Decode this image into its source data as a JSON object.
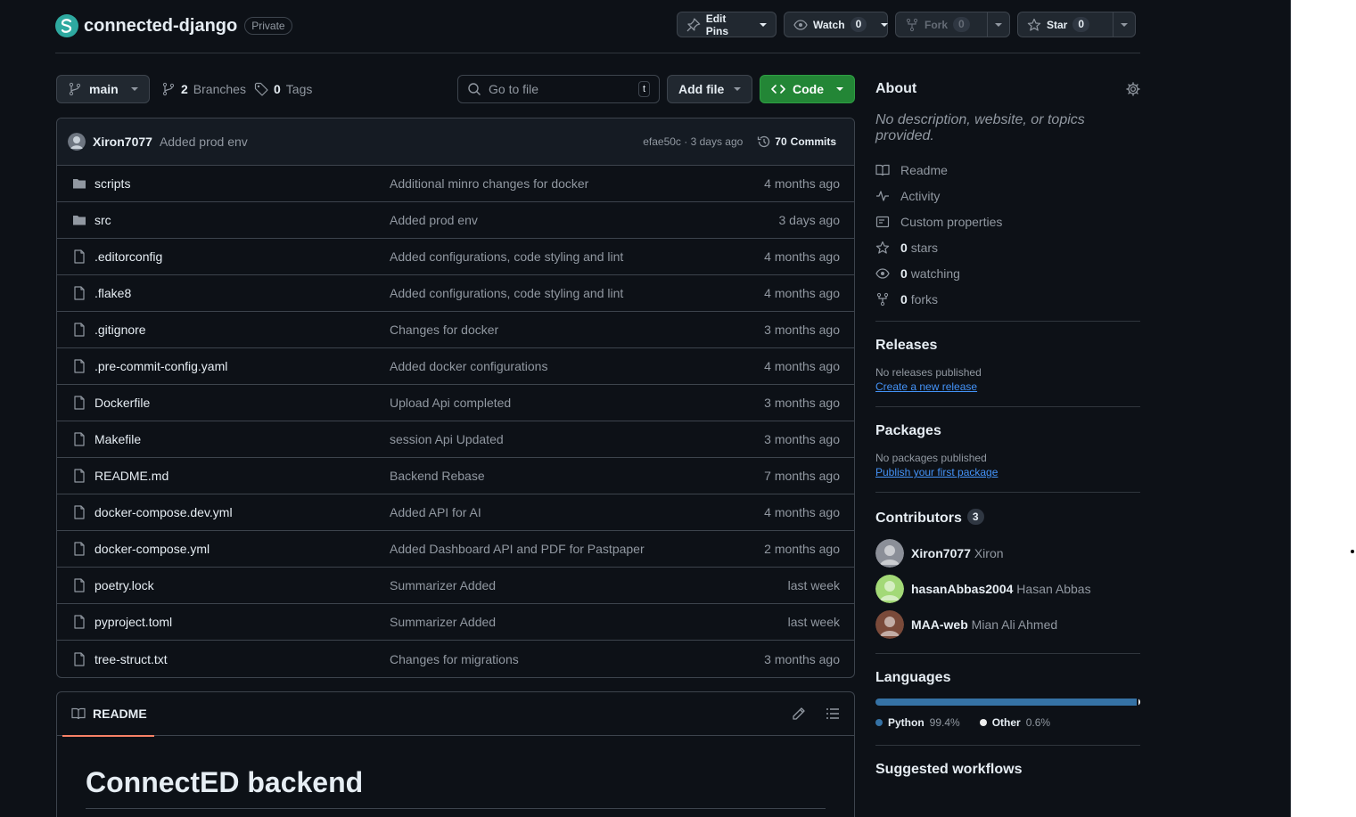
{
  "repo": {
    "name": "connected-django",
    "visibility": "Private"
  },
  "header_actions": {
    "edit_pins": "Edit Pins",
    "watch": {
      "label": "Watch",
      "count": "0"
    },
    "fork": {
      "label": "Fork",
      "count": "0"
    },
    "star": {
      "label": "Star",
      "count": "0"
    }
  },
  "toolbar": {
    "branch": "main",
    "branches_count": "2",
    "branches_label": "Branches",
    "tags_count": "0",
    "tags_label": "Tags",
    "search_placeholder": "Go to file",
    "search_shortcut": "t",
    "add_file": "Add file",
    "code": "Code"
  },
  "latest_commit": {
    "author": "Xiron7077",
    "message": "Added prod env",
    "meta": "efae50c · 3 days ago",
    "commits_count": "70",
    "commits_label": "Commits"
  },
  "files": [
    {
      "name": "scripts",
      "type": "dir",
      "message": "Additional minro changes for docker",
      "date": "4 months ago"
    },
    {
      "name": "src",
      "type": "dir",
      "message": "Added prod env",
      "date": "3 days ago"
    },
    {
      "name": ".editorconfig",
      "type": "file",
      "message": "Added configurations, code styling and lint",
      "date": "4 months ago"
    },
    {
      "name": ".flake8",
      "type": "file",
      "message": "Added configurations, code styling and lint",
      "date": "4 months ago"
    },
    {
      "name": ".gitignore",
      "type": "file",
      "message": "Changes for docker",
      "date": "3 months ago"
    },
    {
      "name": ".pre-commit-config.yaml",
      "type": "file",
      "message": "Added docker configurations",
      "date": "4 months ago"
    },
    {
      "name": "Dockerfile",
      "type": "file",
      "message": "Upload Api completed",
      "date": "3 months ago"
    },
    {
      "name": "Makefile",
      "type": "file",
      "message": "session Api Updated",
      "date": "3 months ago"
    },
    {
      "name": "README.md",
      "type": "file",
      "message": "Backend Rebase",
      "date": "7 months ago"
    },
    {
      "name": "docker-compose.dev.yml",
      "type": "file",
      "message": "Added API for AI",
      "date": "4 months ago"
    },
    {
      "name": "docker-compose.yml",
      "type": "file",
      "message": "Added Dashboard API and PDF for Pastpaper",
      "date": "2 months ago"
    },
    {
      "name": "poetry.lock",
      "type": "file",
      "message": "Summarizer Added",
      "date": "last week"
    },
    {
      "name": "pyproject.toml",
      "type": "file",
      "message": "Summarizer Added",
      "date": "last week"
    },
    {
      "name": "tree-struct.txt",
      "type": "file",
      "message": "Changes for migrations",
      "date": "3 months ago"
    }
  ],
  "readme": {
    "tab": "README",
    "title": "ConnectED backend"
  },
  "about": {
    "title": "About",
    "description": "No description, website, or topics provided.",
    "links": [
      {
        "icon": "book-icon",
        "count": "",
        "label": "Readme"
      },
      {
        "icon": "pulse-icon",
        "count": "",
        "label": "Activity"
      },
      {
        "icon": "note-icon",
        "count": "",
        "label": "Custom properties"
      },
      {
        "icon": "star-icon",
        "count": "0",
        "label": "stars"
      },
      {
        "icon": "eye-icon",
        "count": "0",
        "label": "watching"
      },
      {
        "icon": "fork-icon",
        "count": "0",
        "label": "forks"
      }
    ]
  },
  "releases": {
    "title": "Releases",
    "empty": "No releases published",
    "link": "Create a new release"
  },
  "packages": {
    "title": "Packages",
    "empty": "No packages published",
    "link": "Publish your first package"
  },
  "contributors": {
    "title": "Contributors",
    "count": "3",
    "items": [
      {
        "login": "Xiron7077",
        "name": "Xiron",
        "avatar_color": "#8b8f98"
      },
      {
        "login": "hasanAbbas2004",
        "name": "Hasan Abbas",
        "avatar_color": "#a3d977"
      },
      {
        "login": "MAA-web",
        "name": "Mian Ali Ahmed",
        "avatar_color": "#7a4a3a"
      }
    ]
  },
  "languages": {
    "title": "Languages",
    "items": [
      {
        "name": "Python",
        "percent": "99.4%",
        "value": 99.4,
        "color": "#3572A5"
      },
      {
        "name": "Other",
        "percent": "0.6%",
        "value": 0.6,
        "color": "#ededed"
      }
    ]
  },
  "suggested_workflows": {
    "title": "Suggested workflows"
  },
  "colors": {
    "bg": "#0d1117",
    "border": "#3d444d",
    "accent_green": "#238636",
    "link": "#4493f8",
    "tab_underline": "#f78166"
  }
}
